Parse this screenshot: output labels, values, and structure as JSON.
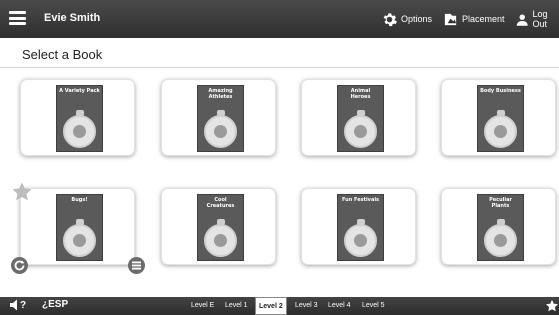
{
  "header": {
    "user_name": "Evie Smith",
    "options_label": "Options",
    "placement_label": "Placement",
    "logout_label": "Log Out"
  },
  "page": {
    "title": "Select a Book"
  },
  "books": [
    {
      "title": "A Variety Pack"
    },
    {
      "title": "Amazing Athletes"
    },
    {
      "title": "Animal Heroes"
    },
    {
      "title": "Body Business"
    },
    {
      "title": "Bugs!"
    },
    {
      "title": "Cool Creatures"
    },
    {
      "title": "Fun Festivals"
    },
    {
      "title": "Peculiar Plants"
    }
  ],
  "footer": {
    "esp_label": "¿ESP",
    "levels": [
      "Level E",
      "Level 1",
      "Level 2",
      "Level 3",
      "Level 4",
      "Level 5"
    ],
    "active_level": "Level 2"
  },
  "colors": {
    "bar": "#333333",
    "accent": "#ffffff"
  }
}
